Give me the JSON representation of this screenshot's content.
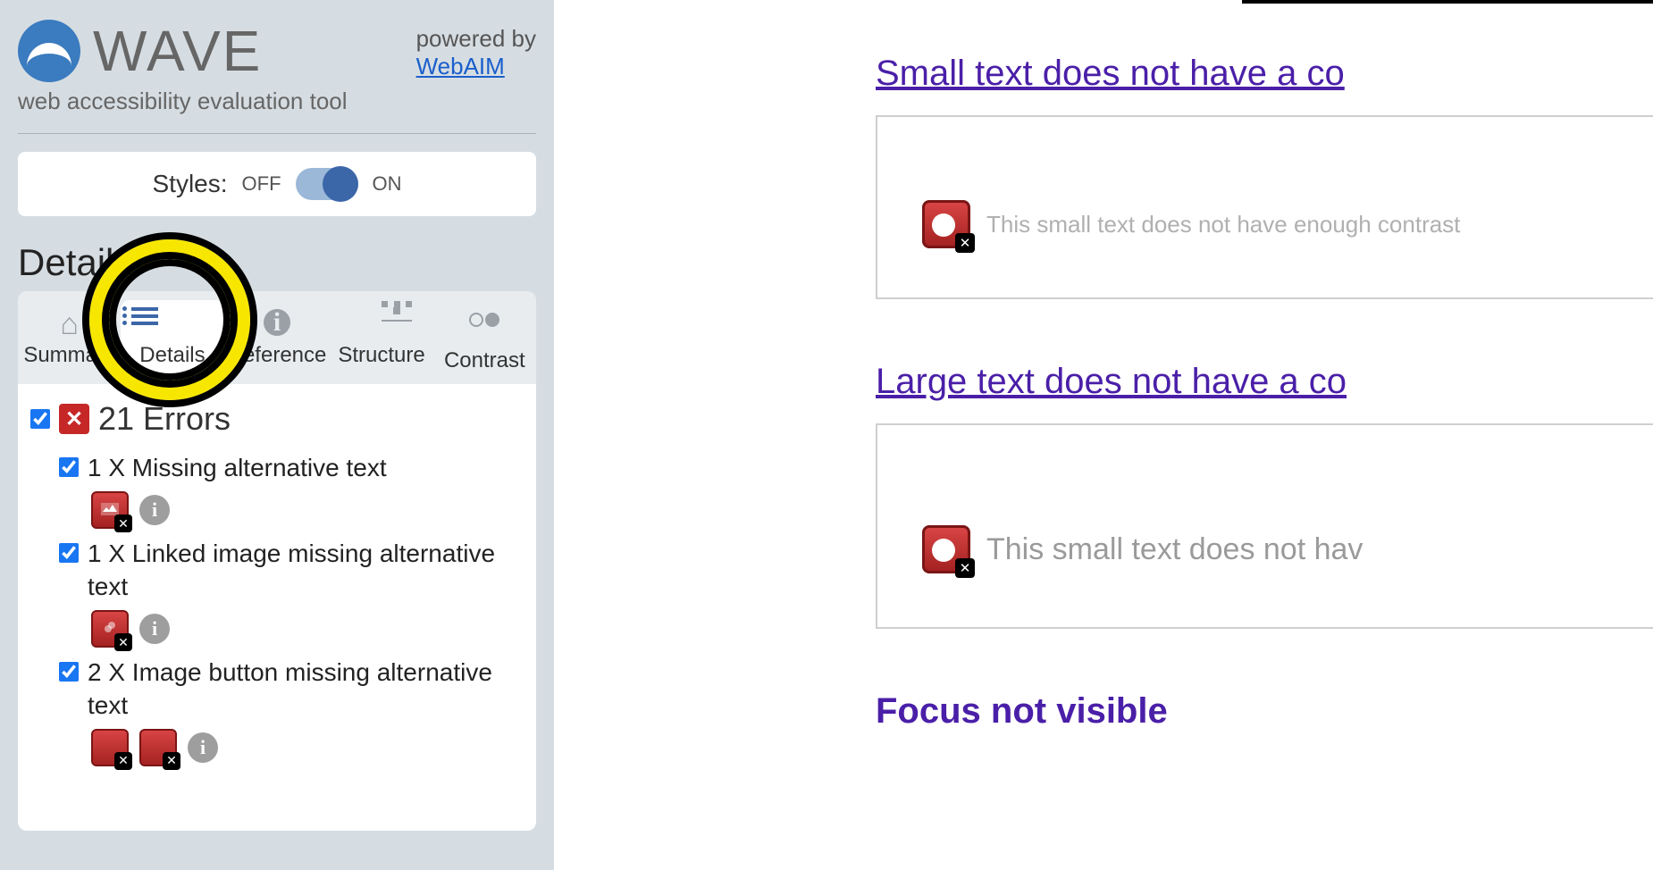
{
  "header": {
    "logo_text": "WAVE",
    "tagline": "web accessibility evaluation tool",
    "powered_by_label": "powered by",
    "powered_by_link": "WebAIM"
  },
  "styles_toggle": {
    "label": "Styles:",
    "off": "OFF",
    "on": "ON",
    "state": "on"
  },
  "section_heading": "Details",
  "tabs": [
    {
      "id": "summary",
      "label": "Summary",
      "active": false
    },
    {
      "id": "details",
      "label": "Details",
      "active": true
    },
    {
      "id": "reference",
      "label": "Reference",
      "active": false
    },
    {
      "id": "structure",
      "label": "Structure",
      "active": false
    },
    {
      "id": "contrast",
      "label": "Contrast",
      "active": false
    }
  ],
  "errors": {
    "count_label": "21 Errors",
    "items": [
      {
        "count_text": "1 X Missing alternative text",
        "icon_instances": 1
      },
      {
        "count_text": "1 X Linked image missing alternative text",
        "icon_instances": 1
      },
      {
        "count_text": "2 X Image button missing alternative text",
        "icon_instances": 2
      }
    ]
  },
  "content": {
    "small_heading": "Small text does not have a co",
    "small_body": "This small text does not have enough contrast",
    "large_heading": "Large text does not have a co",
    "large_body": "This small text does not hav",
    "focus_heading": "Focus not visible"
  }
}
